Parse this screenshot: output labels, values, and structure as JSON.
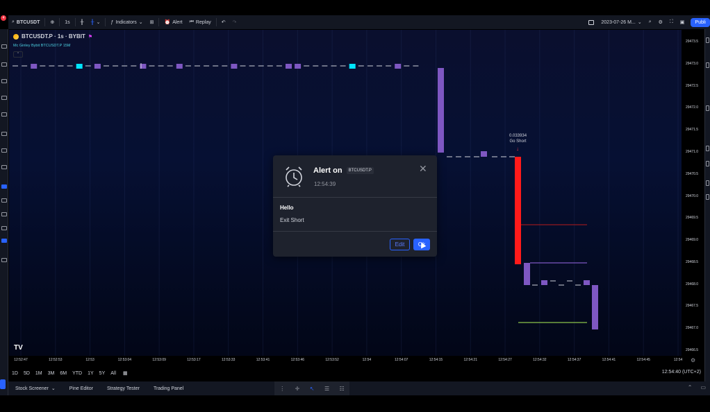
{
  "toolbar": {
    "symbol": "BTCUSDT",
    "interval": "1s",
    "indicators_label": "Indicators",
    "alert_label": "Alert",
    "replay_label": "Replay",
    "date_label": "2023-07-26 M...",
    "publish_label": "Publi",
    "notification_count": "4"
  },
  "legend": {
    "title": "BTCUSDT.P · 1s · BYBIT",
    "indicator": "Mc Ginley Bybit BTCUSDT.P 15M",
    "collapse_glyph": "^"
  },
  "chart_data": {
    "type": "candlestick",
    "symbol": "BTCUSDT.P",
    "ylim": [
      29466.5,
      29473.5
    ],
    "y_ticks": [
      "29473.5",
      "29473.0",
      "29472.5",
      "29472.0",
      "29471.5",
      "29471.0",
      "29470.5",
      "29470.0",
      "29469.5",
      "29469.0",
      "29468.5",
      "29468.0",
      "29467.5",
      "29467.0",
      "29466.5"
    ],
    "x_ticks": [
      "12:52:47",
      "12:52:53",
      "12:53",
      "12:53:04",
      "12:53:09",
      "12:53:17",
      "12:53:33",
      "12:53:41",
      "12:53:46",
      "12:53:52",
      "12:54",
      "12:54:07",
      "12:54:15",
      "12:54:21",
      "12:54:27",
      "12:54:32",
      "12:54:37",
      "12:54:41",
      "12:54:45",
      "12:54"
    ],
    "annotation": {
      "value": "0.033934",
      "label": "Go Short"
    },
    "colors": {
      "up": "#7e57c2",
      "down": "#ff1a1a",
      "doji": "#d1d4dc",
      "cyan": "#00e5ff",
      "green_line": "#8bc34a",
      "red_line": "#b71c1c"
    }
  },
  "range": {
    "buttons": [
      "1D",
      "5D",
      "1M",
      "3M",
      "6M",
      "YTD",
      "1Y",
      "5Y",
      "All"
    ],
    "time": "12:54:40 (UTC+2)"
  },
  "bottom": {
    "tabs": [
      "Stock Screener",
      "Pine Editor",
      "Strategy Tester",
      "Trading Panel"
    ]
  },
  "dialog": {
    "title": "Alert on",
    "badge": "BTCUSDT.P",
    "time": "12:54:39",
    "message_title": "Hello",
    "message": "Exit Short",
    "edit_label": "Edit",
    "ok_label": "Ok"
  }
}
